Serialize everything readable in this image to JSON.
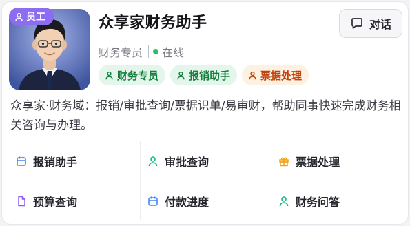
{
  "agent": {
    "role_badge": "员工",
    "name": "众享家财务助手",
    "position": "财务专员",
    "status": "在线",
    "status_color": "#22c55e",
    "description": "众享家·财务域：报销/审批查询/票据识单/易审财，帮助同事快速完成财务相关咨询与办理。"
  },
  "tags": [
    {
      "label": "财务专员",
      "icon": "person-icon",
      "color": "green"
    },
    {
      "label": "报销助手",
      "icon": "person-icon",
      "color": "green"
    },
    {
      "label": "票据处理",
      "icon": "person-icon",
      "color": "orange"
    }
  ],
  "chat_button": {
    "label": "对话",
    "icon": "chat-bubble-icon"
  },
  "quick_actions": [
    {
      "label": "报销助手",
      "icon": "calendar-icon",
      "icon_color": "#3b82f6"
    },
    {
      "label": "审批查询",
      "icon": "person-icon",
      "icon_color": "#10b981"
    },
    {
      "label": "票据处理",
      "icon": "gift-icon",
      "icon_color": "#f59e0b"
    },
    {
      "label": "预算查询",
      "icon": "document-icon",
      "icon_color": "#8b5cf6"
    },
    {
      "label": "付款进度",
      "icon": "calendar-icon",
      "icon_color": "#3b82f6"
    },
    {
      "label": "财务问答",
      "icon": "person-icon",
      "icon_color": "#10b981"
    }
  ],
  "colors": {
    "badge": "#8c6cf0",
    "tag_green_bg": "#e4f5ec",
    "tag_green_text": "#15803d",
    "tag_orange_bg": "#fdf1e2",
    "tag_orange_text": "#c2410c"
  }
}
